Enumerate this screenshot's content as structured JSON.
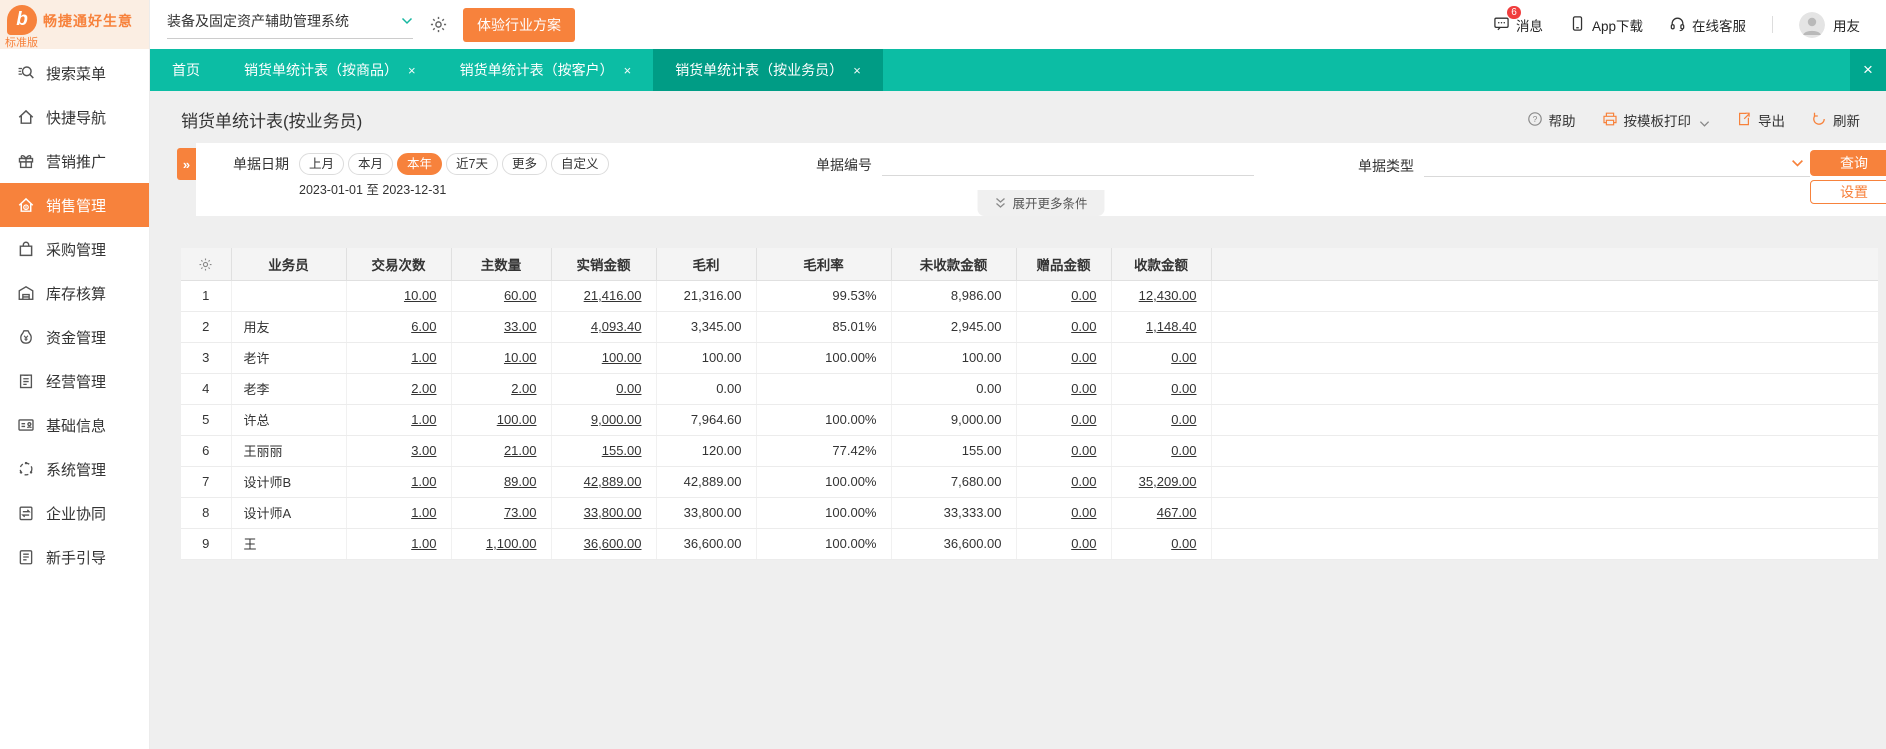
{
  "colors": {
    "accent": "#f7823c",
    "tabbar": "#0cbda4",
    "tab_active": "#009c85",
    "badge": "#f03e3e",
    "logo_bg": "#fbeee3",
    "content_bg": "#efefef"
  },
  "sidebar": {
    "logo_title": "畅捷通好生意",
    "logo_subtitle": "标准版",
    "logo_glyph": "b",
    "items": [
      {
        "name": "search-menu",
        "icon": "search-icon",
        "label": "搜索菜单",
        "active": false
      },
      {
        "name": "quick-nav",
        "icon": "home-icon",
        "label": "快捷导航",
        "active": false
      },
      {
        "name": "marketing",
        "icon": "gift-icon",
        "label": "营销推广",
        "active": false
      },
      {
        "name": "sales-mgmt",
        "icon": "sales-icon",
        "label": "销售管理",
        "active": true
      },
      {
        "name": "purchase-mgmt",
        "icon": "bag-icon",
        "label": "采购管理",
        "active": false
      },
      {
        "name": "inventory-mgmt",
        "icon": "warehouse-icon",
        "label": "库存核算",
        "active": false
      },
      {
        "name": "funds-mgmt",
        "icon": "moneybag-icon",
        "label": "资金管理",
        "active": false
      },
      {
        "name": "operations-mgmt",
        "icon": "clipboard-icon",
        "label": "经营管理",
        "active": false
      },
      {
        "name": "basic-info",
        "icon": "idcard-icon",
        "label": "基础信息",
        "active": false
      },
      {
        "name": "system-mgmt",
        "icon": "dotted-circle-icon",
        "label": "系统管理",
        "active": false
      },
      {
        "name": "enterprise-collab",
        "icon": "sync-doc-icon",
        "label": "企业协同",
        "active": false
      },
      {
        "name": "beginner-guide",
        "icon": "guide-doc-icon",
        "label": "新手引导",
        "active": false
      }
    ]
  },
  "header": {
    "system_select": "装备及固定资产辅助管理系统",
    "trial_button": "体验行业方案",
    "message_label": "消息",
    "message_badge": "6",
    "app_download_label": "App下载",
    "online_service_label": "在线客服",
    "username": "用友"
  },
  "tabs": [
    {
      "name": "tab-home",
      "label": "首页",
      "closable": false,
      "active": false
    },
    {
      "name": "tab-by-product",
      "label": "销货单统计表（按商品）",
      "closable": true,
      "active": false
    },
    {
      "name": "tab-by-customer",
      "label": "销货单统计表（按客户）",
      "closable": true,
      "active": false
    },
    {
      "name": "tab-by-salesperson",
      "label": "销货单统计表（按业务员）",
      "closable": true,
      "active": true
    }
  ],
  "close_all_label": "×",
  "page": {
    "title": "销货单统计表(按业务员)",
    "toolbar": {
      "help": "帮助",
      "print": "按模板打印",
      "export": "导出",
      "refresh": "刷新"
    }
  },
  "filters": {
    "date_label": "单据日期",
    "date_options": [
      "上月",
      "本月",
      "本年",
      "近7天",
      "更多",
      "自定义"
    ],
    "date_active": "本年",
    "date_range": "2023-01-01 至 2023-12-31",
    "doc_no_label": "单据编号",
    "doc_no_value": "",
    "doc_type_label": "单据类型",
    "doc_type_value": "",
    "expand_more": "展开更多条件",
    "collapse_glyph": "»",
    "query_button": "查询",
    "settings_button": "设置"
  },
  "table": {
    "columns": [
      "业务员",
      "交易次数",
      "主数量",
      "实销金额",
      "毛利",
      "毛利率",
      "未收款金额",
      "赠品金额",
      "收款金额"
    ],
    "link_columns": [
      0,
      1,
      2,
      6,
      7
    ],
    "rows": [
      {
        "no": "1",
        "name": "",
        "values": [
          "10.00",
          "60.00",
          "21,416.00",
          "21,316.00",
          "99.53%",
          "8,986.00",
          "0.00",
          "12,430.00"
        ]
      },
      {
        "no": "2",
        "name": "用友",
        "values": [
          "6.00",
          "33.00",
          "4,093.40",
          "3,345.00",
          "85.01%",
          "2,945.00",
          "0.00",
          "1,148.40"
        ]
      },
      {
        "no": "3",
        "name": "老许",
        "values": [
          "1.00",
          "10.00",
          "100.00",
          "100.00",
          "100.00%",
          "100.00",
          "0.00",
          "0.00"
        ]
      },
      {
        "no": "4",
        "name": "老李",
        "values": [
          "2.00",
          "2.00",
          "0.00",
          "0.00",
          "",
          "0.00",
          "0.00",
          "0.00"
        ]
      },
      {
        "no": "5",
        "name": "许总",
        "values": [
          "1.00",
          "100.00",
          "9,000.00",
          "7,964.60",
          "100.00%",
          "9,000.00",
          "0.00",
          "0.00"
        ]
      },
      {
        "no": "6",
        "name": "王丽丽",
        "values": [
          "3.00",
          "21.00",
          "155.00",
          "120.00",
          "77.42%",
          "155.00",
          "0.00",
          "0.00"
        ]
      },
      {
        "no": "7",
        "name": "设计师B",
        "values": [
          "1.00",
          "89.00",
          "42,889.00",
          "42,889.00",
          "100.00%",
          "7,680.00",
          "0.00",
          "35,209.00"
        ]
      },
      {
        "no": "8",
        "name": "设计师A",
        "values": [
          "1.00",
          "73.00",
          "33,800.00",
          "33,800.00",
          "100.00%",
          "33,333.00",
          "0.00",
          "467.00"
        ]
      },
      {
        "no": "9",
        "name": "王",
        "values": [
          "1.00",
          "1,100.00",
          "36,600.00",
          "36,600.00",
          "100.00%",
          "36,600.00",
          "0.00",
          "0.00"
        ]
      }
    ]
  }
}
